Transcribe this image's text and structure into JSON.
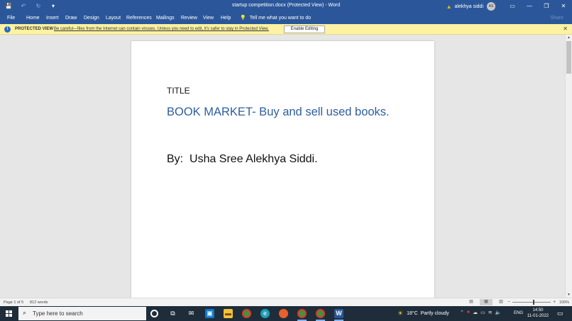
{
  "window": {
    "title": "startup competition.docx (Protected View)  -  Word",
    "user_name": "alekhya siddi",
    "user_initials": "AS",
    "quick_access": {
      "save": "💾",
      "undo": "↶",
      "redo": "↻",
      "customize": "▾"
    },
    "controls": {
      "ribbon_display": "▭",
      "minimize": "—",
      "restore": "❐",
      "close": "✕"
    }
  },
  "ribbon": {
    "tabs": [
      "File",
      "Home",
      "Insert",
      "Draw",
      "Design",
      "Layout",
      "References",
      "Mailings",
      "Review",
      "View",
      "Help"
    ],
    "tell_me": "Tell me what you want to do",
    "share": "Share"
  },
  "protected_view": {
    "label": "PROTECTED VIEW",
    "message": "Be careful—files from the Internet can contain viruses. Unless you need to edit, it's safer to stay in Protected View.",
    "button": "Enable Editing"
  },
  "document": {
    "title_label": "TITLE",
    "heading": "BOOK MARKET- Buy and sell used books.",
    "author_line": "By:  Usha Sree Alekhya Siddi."
  },
  "status_bar": {
    "page": "Page 1 of 5",
    "words": "812 words",
    "zoom": "100%"
  },
  "taskbar": {
    "search_placeholder": "Type here to search",
    "weather_temp": "18°C",
    "weather_desc": "Partly cloudy",
    "language": "ENG",
    "time": "14:50",
    "date": "11-01-2022"
  },
  "colors": {
    "word_blue": "#2b579a",
    "heading_blue": "#2e5e9e",
    "protected_bg": "#fcf2a2",
    "taskbar_bg": "#1f2d3a"
  },
  "icons": {
    "taskbar": [
      "cortana-icon",
      "task-view-icon",
      "mail-icon",
      "photos-icon",
      "file-explorer-icon",
      "chrome-icon",
      "edge-icon",
      "firefox-icon",
      "chrome-profile-icon",
      "chrome-profile-2-icon",
      "word-icon"
    ]
  }
}
